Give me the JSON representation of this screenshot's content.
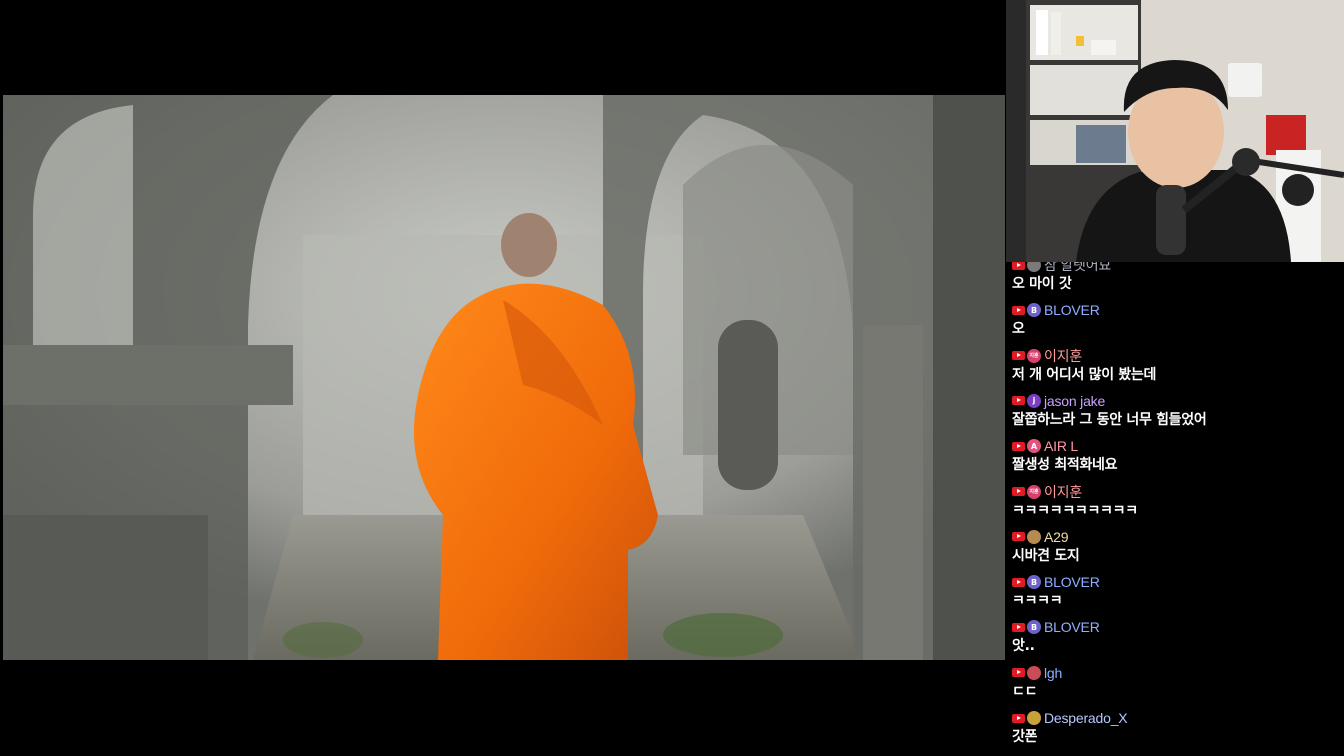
{
  "chat": {
    "messages": [
      {
        "author": "잠 알렛어묘",
        "text": "오 마이 갓",
        "avatar_color": "#7a7a7a",
        "name_color": "#aeb3bf"
      },
      {
        "author": "BLOVER",
        "text": "오",
        "avatar_color": "#6c63c9",
        "avatar_letter": "B",
        "name_color": "#8fb0ff"
      },
      {
        "author": "이지훈",
        "text": "저 개 어디서 많이 봤는데",
        "avatar_color": "#d9416d",
        "avatar_letter": "지훈",
        "name_color": "#ff9a9a"
      },
      {
        "author": "jason jake",
        "text": "잘쫍하느라 그 동안 너무 힘들었어",
        "avatar_color": "#7b3fc2",
        "avatar_letter": "j",
        "name_color": "#cba2ff"
      },
      {
        "author": "AIR L",
        "text": "짤생성 최적화네요",
        "avatar_color": "#e2547f",
        "avatar_letter": "A",
        "name_color": "#ff9aa6"
      },
      {
        "author": "이지훈",
        "text": "ㅋㅋㅋㅋㅋㅋㅋㅋㅋㅋ",
        "avatar_color": "#d9416d",
        "avatar_letter": "지훈",
        "name_color": "#ff9a9a"
      },
      {
        "author": "A29",
        "text": "시바견 도지",
        "avatar_color": "#b78a52",
        "name_color": "#f0dfa6"
      },
      {
        "author": "BLOVER",
        "text": "ㅋㅋㅋㅋ",
        "avatar_color": "#6c63c9",
        "avatar_letter": "B",
        "name_color": "#8fb0ff"
      },
      {
        "author": "BLOVER",
        "text": "앗..",
        "avatar_color": "#6c63c9",
        "avatar_letter": "B",
        "name_color": "#8fb0ff"
      },
      {
        "author": "lgh",
        "text": "ㄷㄷ",
        "avatar_color": "#c94c57",
        "name_color": "#8fb0ff"
      },
      {
        "author": "Desperado_X",
        "text": "갓폰",
        "avatar_color": "#c9a33a",
        "name_color": "#b8c6ff"
      }
    ]
  }
}
